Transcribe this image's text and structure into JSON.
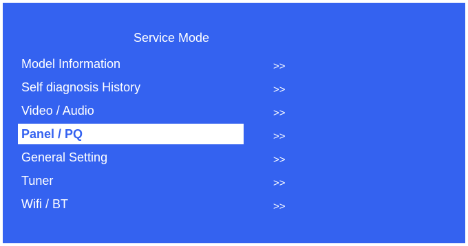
{
  "title": "Service Mode",
  "colors": {
    "background": "#3462f0",
    "text": "#ffffff",
    "highlight_bg": "#ffffff",
    "highlight_text": "#3462f0"
  },
  "menu": {
    "selected_index": 3,
    "items": [
      {
        "label": "Model Information",
        "arrow": ">>"
      },
      {
        "label": "Self diagnosis History",
        "arrow": ">>"
      },
      {
        "label": "Video / Audio",
        "arrow": ">>"
      },
      {
        "label": "Panel / PQ",
        "arrow": ">>"
      },
      {
        "label": "General Setting",
        "arrow": ">>"
      },
      {
        "label": "Tuner",
        "arrow": ">>"
      },
      {
        "label": "Wifi / BT",
        "arrow": ">>"
      }
    ]
  }
}
